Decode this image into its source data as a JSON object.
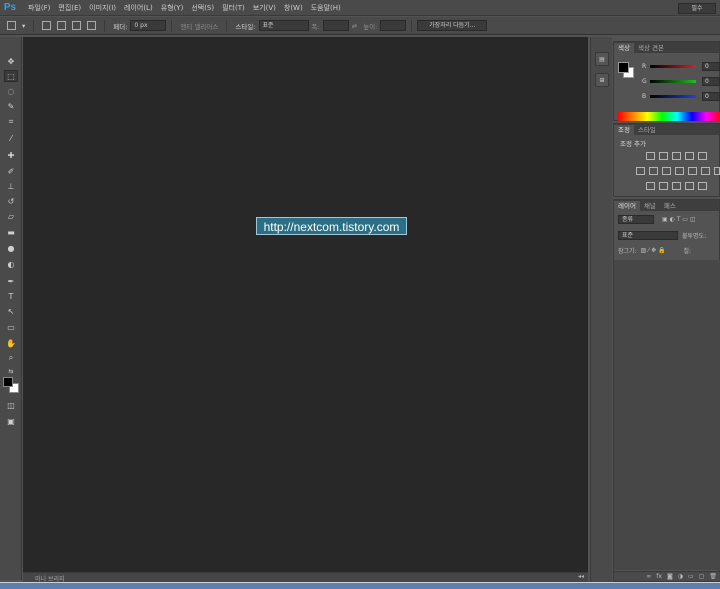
{
  "app": {
    "logo": "Ps"
  },
  "menu": [
    "파일(F)",
    "편집(E)",
    "이미지(I)",
    "레이어(L)",
    "유형(Y)",
    "선택(S)",
    "필터(T)",
    "보기(V)",
    "창(W)",
    "도움말(H)"
  ],
  "workspace": {
    "label": "필수"
  },
  "options": {
    "feather_label": "페더:",
    "feather_value": "0 px",
    "antialias_label": "앤티 앨리어스",
    "style_label": "스타일:",
    "style_value": "표준",
    "width_label": "폭:",
    "height_label": "높이:",
    "refine_edge": "가장자리 다듬기..."
  },
  "canvas": {
    "overlay_text": "http://nextcom.tistory.com"
  },
  "status": {
    "text": "미니 브리지"
  },
  "panels": {
    "color": {
      "tabs": [
        "색상",
        "색상 견본"
      ],
      "channels": [
        {
          "letter": "R",
          "value": "0",
          "color": "#e02020"
        },
        {
          "letter": "G",
          "value": "0",
          "color": "#20c020"
        },
        {
          "letter": "B",
          "value": "0",
          "color": "#2040e0"
        }
      ]
    },
    "adjustments": {
      "tabs": [
        "조정",
        "스타일"
      ],
      "title": "조정 추가"
    },
    "layers": {
      "tabs": [
        "레이어",
        "채널",
        "패스"
      ],
      "kind_label": "종류",
      "blend_mode": "표준",
      "opacity_label": "불투명도:",
      "lock_label": "잠그기:",
      "fill_label": "칠:"
    }
  },
  "colors": {
    "fg": "#000000",
    "bg": "#ffffff",
    "accent": "#2fa3e6",
    "canvas": "#282828",
    "chrome": "#535353"
  }
}
